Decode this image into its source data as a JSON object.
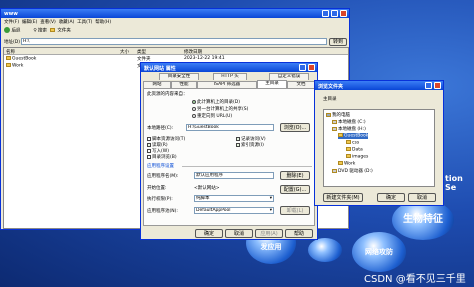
{
  "desktop": {
    "brand_text": "tion Se",
    "orbs": [
      "生物特征",
      "新编写\n发应用",
      "网络攻防"
    ],
    "watermark": "CSDN @看不见三千里"
  },
  "explorer": {
    "title": "www",
    "menu": [
      "文件(F)",
      "编辑(E)",
      "查看(V)",
      "收藏(A)",
      "工具(T)",
      "帮助(H)"
    ],
    "toolbar": {
      "back": "后退",
      "search": "搜索",
      "folders": "文件夹"
    },
    "address_label": "地址(D)",
    "address_value": "H:\\",
    "go": "转到",
    "columns": [
      "名称",
      "大小",
      "类型",
      "修改日期"
    ],
    "rows": [
      {
        "name": "GuestBook",
        "size": "",
        "type": "文件夹",
        "date": "2023-12-22 19:41"
      },
      {
        "name": "Work",
        "size": "",
        "type": "文件夹",
        "date": ""
      }
    ]
  },
  "props": {
    "title": "默认网站 属性",
    "tabs_row1": [
      "目录安全性",
      "HTTP 头",
      "自定义错误"
    ],
    "tabs_row2": [
      "网站",
      "性能",
      "ISAPI 筛选器",
      "主目录",
      "文档"
    ],
    "source_label": "此资源的内容来自：",
    "radios": [
      "此计算机上的目录(D)",
      "另一台计算机上的共享(S)",
      "重定向到 URL(U)"
    ],
    "local_path_label": "本地路径(C):",
    "local_path": "H:\\GuestBook",
    "browse": "浏览(O)...",
    "checks_left": [
      "脚本资源访问(T)",
      "读取(R)",
      "写入(W)",
      "目录浏览(B)"
    ],
    "checks_right": [
      "记录访问(V)",
      "索引资源(I)"
    ],
    "app_settings_label": "应用程序设置",
    "app_name_label": "应用程序名(M):",
    "app_name": "默认应用程序",
    "remove": "删除(E)",
    "start_point_label": "开始位置:",
    "start_point": "<默认网站>",
    "config": "配置(G)...",
    "exec_perm_label": "执行权限(P):",
    "exec_perm": "纯脚本",
    "app_pool_label": "应用程序池(N):",
    "app_pool": "DefaultAppPool",
    "unload": "卸载(L)",
    "ok": "确定",
    "cancel": "取消",
    "apply": "应用(A)",
    "help": "帮助"
  },
  "browse": {
    "title": "浏览文件夹",
    "header": "主目录",
    "tree": [
      {
        "label": "我的电脑",
        "level": 0
      },
      {
        "label": "本地磁盘 (C:)",
        "level": 1
      },
      {
        "label": "本地磁盘 (H:)",
        "level": 1
      },
      {
        "label": "GuestBook",
        "level": 2,
        "selected": true
      },
      {
        "label": "css",
        "level": 3
      },
      {
        "label": "Data",
        "level": 3
      },
      {
        "label": "images",
        "level": 3
      },
      {
        "label": "Work",
        "level": 2
      },
      {
        "label": "DVD 驱动器 (D:)",
        "level": 1
      }
    ],
    "new_folder": "新建文件夹(M)",
    "ok": "确定",
    "cancel": "取消"
  }
}
